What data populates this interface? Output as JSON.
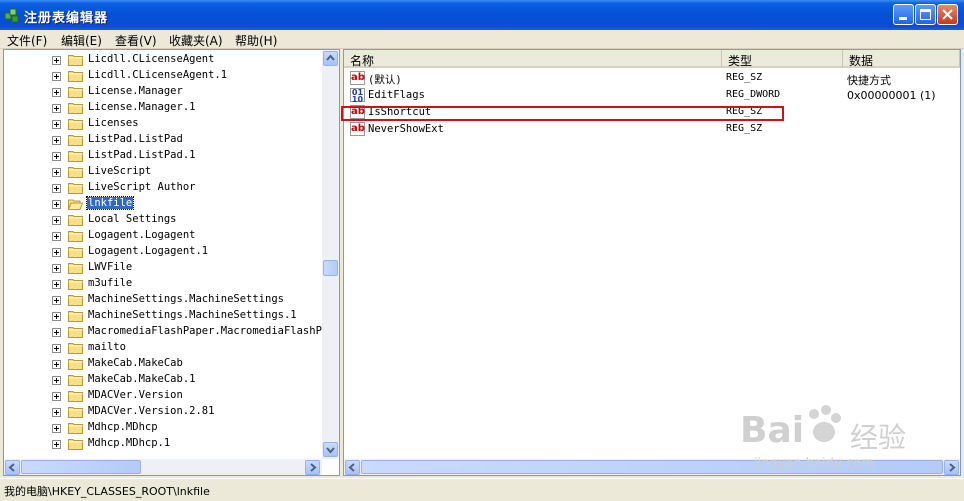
{
  "window": {
    "title": "注册表编辑器"
  },
  "menu": [
    "文件(F)",
    "编辑(E)",
    "查看(V)",
    "收藏夹(A)",
    "帮助(H)"
  ],
  "tree": {
    "items": [
      "Licdll.CLicenseAgent",
      "Licdll.CLicenseAgent.1",
      "License.Manager",
      "License.Manager.1",
      "Licenses",
      "ListPad.ListPad",
      "ListPad.ListPad.1",
      "LiveScript",
      "LiveScript Author",
      "lnkfile",
      "Local Settings",
      "Logagent.Logagent",
      "Logagent.Logagent.1",
      "LWVFile",
      "m3ufile",
      "MachineSettings.MachineSettings",
      "MachineSettings.MachineSettings.1",
      "MacromediaFlashPaper.MacromediaFlashPap",
      "mailto",
      "MakeCab.MakeCab",
      "MakeCab.MakeCab.1",
      "MDACVer.Version",
      "MDACVer.Version.2.81",
      "Mdhcp.MDhcp",
      "Mdhcp.MDhcp.1"
    ],
    "selected": "lnkfile"
  },
  "list": {
    "columns": [
      "名称",
      "类型",
      "数据"
    ],
    "rows": [
      {
        "name": "(默认)",
        "type": "REG_SZ",
        "data": "快捷方式",
        "icon": "string-value-icon"
      },
      {
        "name": "EditFlags",
        "type": "REG_DWORD",
        "data": "0x00000001 (1)",
        "icon": "binary-value-icon"
      },
      {
        "name": "IsShortcut",
        "type": "REG_SZ",
        "data": "",
        "icon": "string-value-icon"
      },
      {
        "name": "NeverShowExt",
        "type": "REG_SZ",
        "data": "",
        "icon": "string-value-icon"
      }
    ],
    "highlighted": "IsShortcut"
  },
  "status": {
    "path": "我的电脑\\HKEY_CLASSES_ROOT\\lnkfile"
  },
  "watermark": {
    "brand": "Bai",
    "brand2": "经验",
    "url": "jingyan.baidu.com"
  },
  "colors": {
    "titlebar": "#0a5fe0",
    "selection": "#316ac5",
    "highlight_box": "#d0101a"
  }
}
